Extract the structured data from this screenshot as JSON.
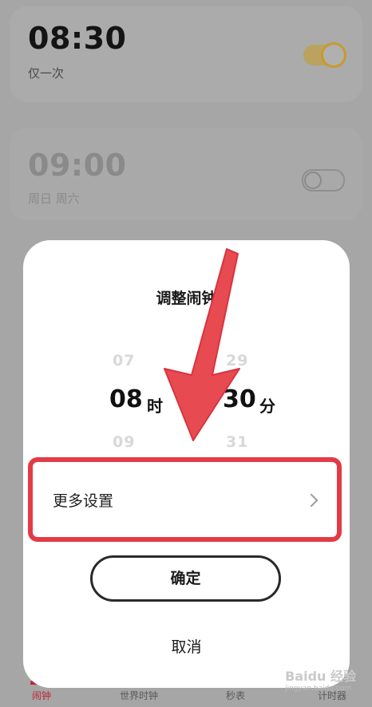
{
  "alarms": [
    {
      "time": "08:30",
      "repeat": "仅一次",
      "enabled": true
    },
    {
      "time": "09:00",
      "repeat": "周日  周六",
      "enabled": false
    }
  ],
  "bottom_nav": {
    "alarm": "闹钟",
    "world_clock": "世界时钟",
    "stopwatch": "秒表",
    "timer": "计时器"
  },
  "dialog": {
    "title": "调整闹钟",
    "hour": {
      "prev": "07",
      "selected": "08",
      "next": "09",
      "unit": "时"
    },
    "minute": {
      "prev": "29",
      "selected": "30",
      "next": "31",
      "unit": "分"
    },
    "more_settings": "更多设置",
    "confirm": "确定",
    "cancel": "取消"
  },
  "watermark": {
    "brand": "Baidu 经验",
    "url": "jingyan.baidu.com"
  },
  "colors": {
    "highlight": "#e23b46",
    "accent_active_tab": "#c0273a",
    "toggle_on": "#c99a2b"
  }
}
